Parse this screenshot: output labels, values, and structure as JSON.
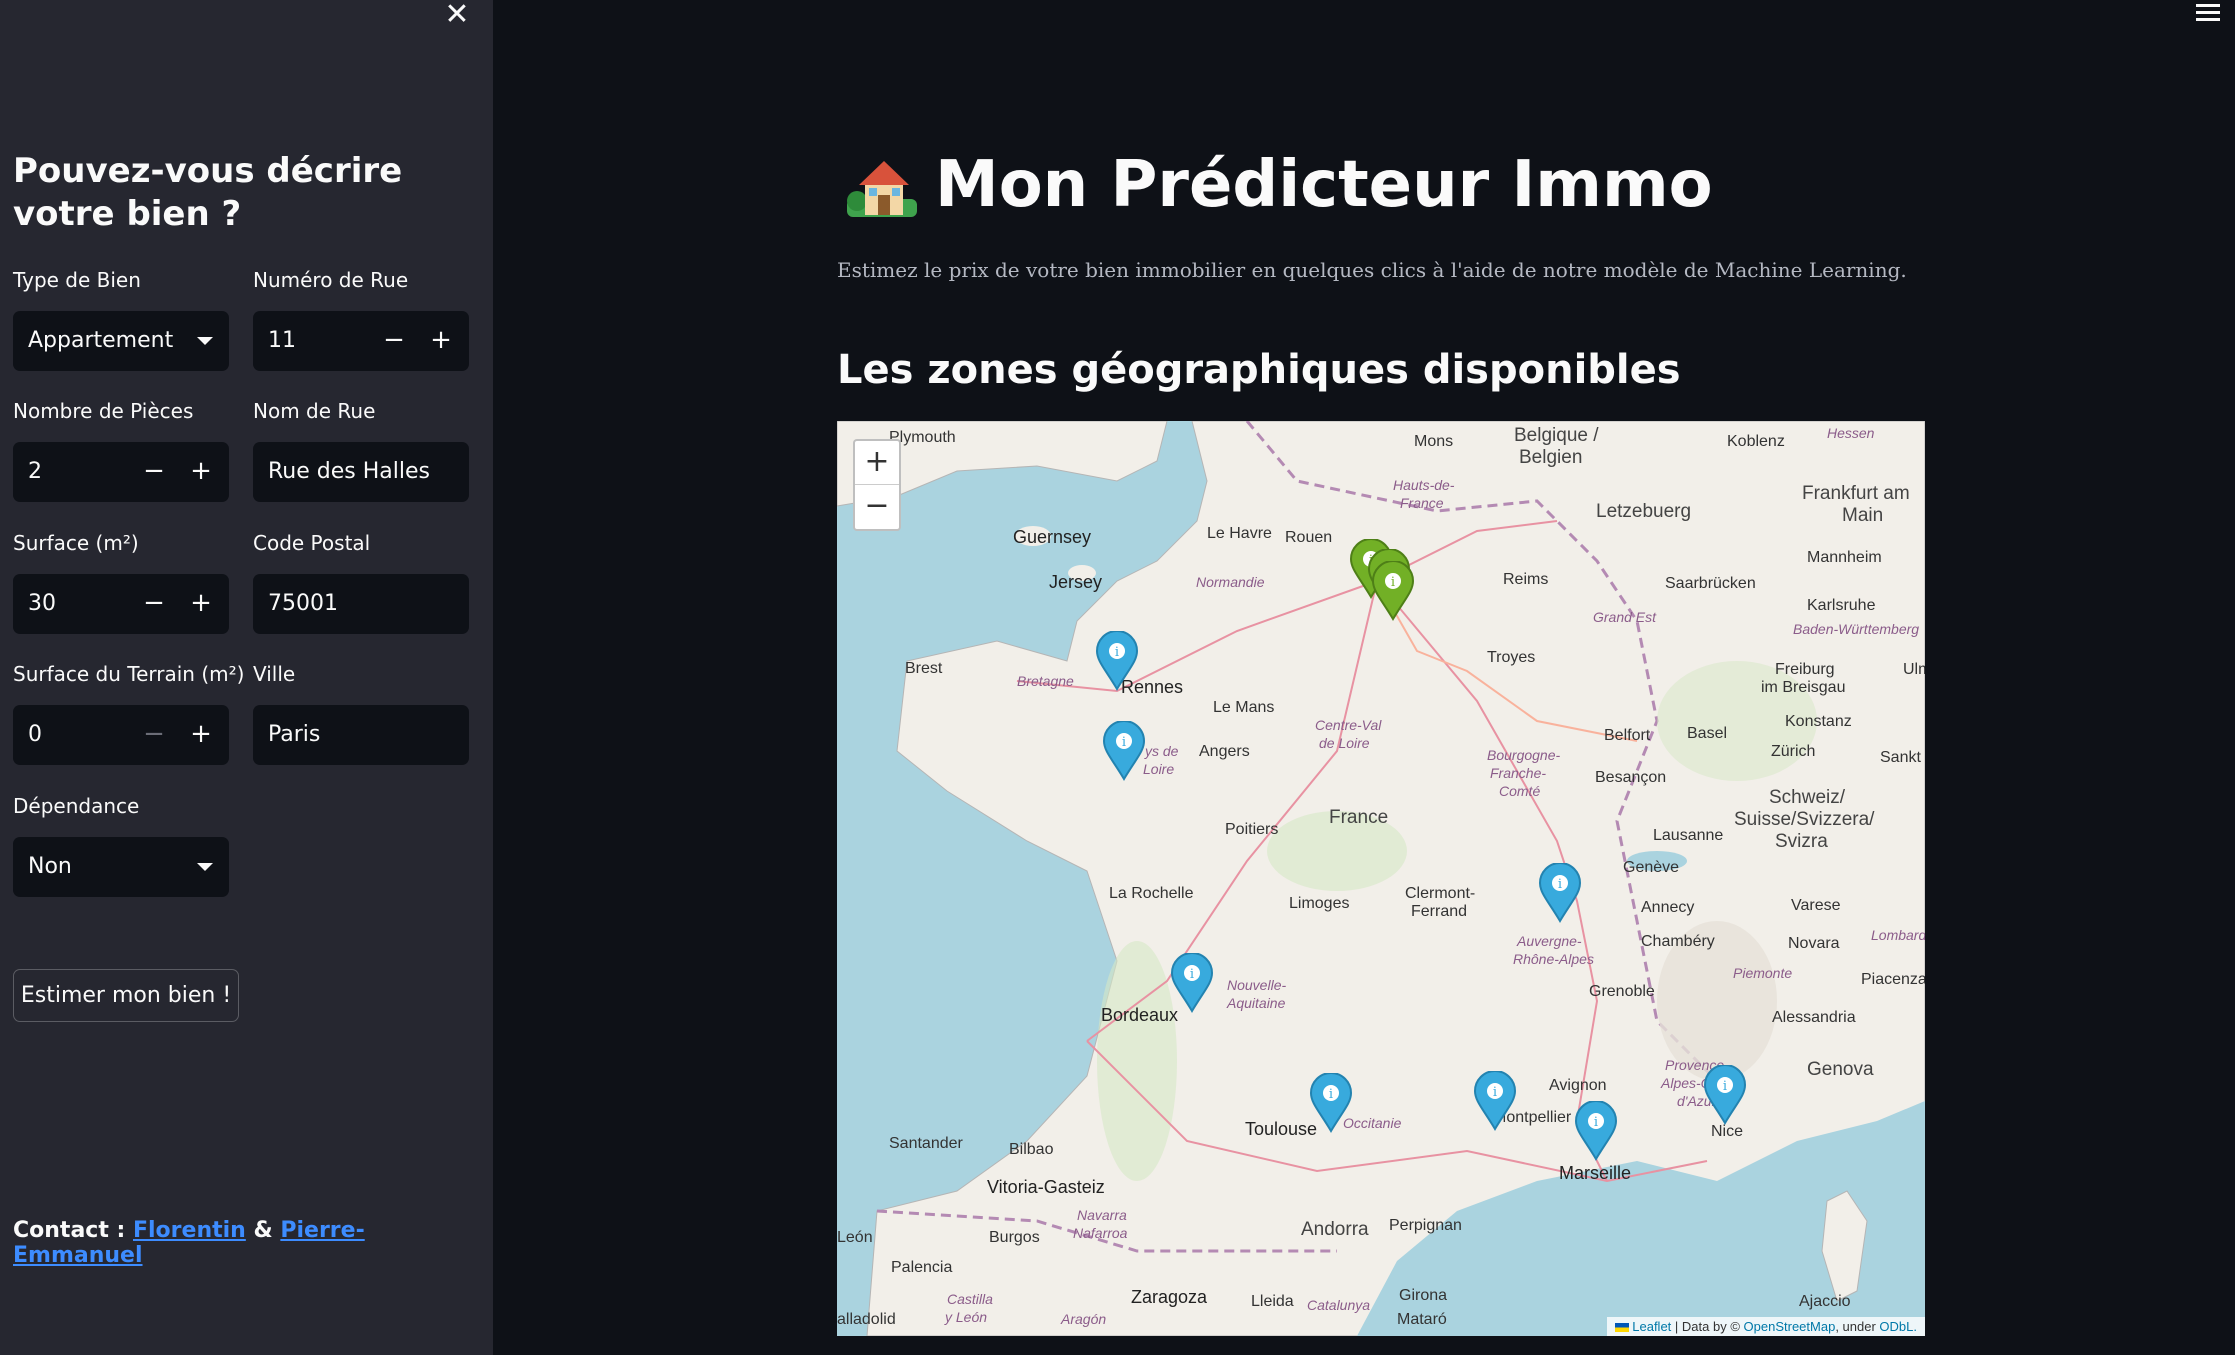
{
  "sidebar": {
    "close_glyph": "✕",
    "title": "Pouvez-vous décrire votre bien ?",
    "fields": {
      "type_bien": {
        "label": "Type de Bien",
        "value": "Appartement"
      },
      "numero_rue": {
        "label": "Numéro de Rue",
        "value": "11"
      },
      "nombre_pieces": {
        "label": "Nombre de Pièces",
        "value": "2"
      },
      "nom_rue": {
        "label": "Nom de Rue",
        "value": "Rue des Halles"
      },
      "surface": {
        "label": "Surface (m²)",
        "value": "30"
      },
      "code_postal": {
        "label": "Code Postal",
        "value": "75001"
      },
      "surface_terrain": {
        "label": "Surface du Terrain (m²)",
        "value": "0"
      },
      "ville": {
        "label": "Ville",
        "value": "Paris"
      },
      "dependance": {
        "label": "Dépendance",
        "value": "Non"
      }
    },
    "stepper": {
      "minus": "−",
      "plus": "+"
    },
    "submit_label": "Estimer mon bien !",
    "contact": {
      "prefix": "Contact :",
      "name1": "Florentin",
      "separator": "&",
      "name2": "Pierre-Emmanuel"
    }
  },
  "main": {
    "title": "Mon Prédicteur Immo",
    "title_icon": "house-with-garden-icon",
    "subtitle": "Estimez le prix de votre bien immobilier en quelques clics à l'aide de notre modèle de Machine Learning.",
    "map_heading": "Les zones géographiques disponibles"
  },
  "map": {
    "zoom_in": "+",
    "zoom_out": "−",
    "attribution": {
      "leaflet": "Leaflet",
      "text1": "| Data by ©",
      "osm": "OpenStreetMap",
      "text2": ", under",
      "odbl": "ODbL."
    },
    "labels": {
      "plymouth": "Plymouth",
      "guernsey": "Guernsey",
      "jersey": "Jersey",
      "le_havre": "Le Havre",
      "rouen": "Rouen",
      "normandie": "Normandie",
      "mons": "Mons",
      "belgique": "Belgique /",
      "belgien": "Belgien",
      "hauts_de": "Hauts-de-",
      "france_r": "France",
      "koblenz": "Koblenz",
      "hessen": "Hessen",
      "frankfurt": "Frankfurt am",
      "main_city": "Main",
      "letzebuerg": "Letzebuerg",
      "mannheim": "Mannheim",
      "saarbrucken": "Saarbrücken",
      "reims": "Reims",
      "karlsruhe": "Karlsruhe",
      "grand_est": "Grand Est",
      "baden": "Baden-Württemberg",
      "brest": "Brest",
      "bretagne": "Bretagne",
      "rennes": "Rennes",
      "troyes": "Troyes",
      "freiburg": "Freiburg",
      "im_breisgau": "im Breisgau",
      "ulm": "Ulm",
      "le_mans": "Le Mans",
      "angers": "Angers",
      "pays_de": "ys de",
      "loire": "Loire",
      "centre_val": "Centre-Val",
      "de_loire": "de Loire",
      "bourgogne": "Bourgogne-",
      "franche": "Franche-",
      "comte": "Comté",
      "belfort": "Belfort",
      "basel": "Basel",
      "konstanz": "Konstanz",
      "zurich": "Zürich",
      "sankt": "Sankt",
      "besancon": "Besançon",
      "schweiz": "Schweiz/",
      "suisse": "Suisse/Svizzera/",
      "svizra": "Svizra",
      "france": "France",
      "poitiers": "Poitiers",
      "lausanne": "Lausanne",
      "geneve": "Genève",
      "la_rochelle": "La Rochelle",
      "limoges": "Limoges",
      "clermont": "Clermont-",
      "ferrand": "Ferrand",
      "annecy": "Annecy",
      "varese": "Varese",
      "auvergne": "Auvergne-",
      "rhone": "Rhône-Alpes",
      "chambery": "Chambéry",
      "novara": "Novara",
      "lombardia": "Lombardi",
      "nouvelle": "Nouvelle-",
      "aquitaine": "Aquitaine",
      "piemonte": "Piemonte",
      "piacenza": "Piacenza",
      "bordeaux": "Bordeaux",
      "grenoble": "Grenoble",
      "alessandria": "Alessandria",
      "provence": "Provence-",
      "alpes": "Alpes-Côte",
      "dazur": "d'Azur",
      "genova": "Genova",
      "avignon": "Avignon",
      "toulouse": "Toulouse",
      "occitanie": "Occitanie",
      "montpellier": "Montpellier",
      "nice": "Nice",
      "marseille": "Marseille",
      "santander": "Santander",
      "bilbao": "Bilbao",
      "vitoria": "Vitoria-Gasteiz",
      "navarra": "Navarra",
      "nafarroa": "Nafarroa",
      "burgos": "Burgos",
      "andorra": "Andorra",
      "perpignan": "Perpignan",
      "leon": "León",
      "palencia": "Palencia",
      "castilla": "Castilla",
      "y_leon": "y León",
      "zaragoza": "Zaragoza",
      "lleida": "Lleida",
      "catalunya": "Catalunya",
      "girona": "Girona",
      "mataro": "Mataró",
      "ajaccio": "Ajaccio",
      "valladolid": "alladolid",
      "aragon": "Aragón"
    },
    "markers": [
      {
        "name": "Paris",
        "color": "#72b026"
      },
      {
        "name": "Rennes",
        "color": "#38aadd"
      },
      {
        "name": "Nantes",
        "color": "#38aadd"
      },
      {
        "name": "Lyon",
        "color": "#38aadd"
      },
      {
        "name": "Bordeaux",
        "color": "#38aadd"
      },
      {
        "name": "Toulouse",
        "color": "#38aadd"
      },
      {
        "name": "Montpellier",
        "color": "#38aadd"
      },
      {
        "name": "Marseille",
        "color": "#38aadd"
      },
      {
        "name": "Nice",
        "color": "#38aadd"
      }
    ]
  },
  "colors": {
    "accent_link": "#3d8cff",
    "marker_blue": "#38aadd",
    "marker_green": "#72b026",
    "sea": "#aad3df",
    "land": "#f2efe9"
  }
}
